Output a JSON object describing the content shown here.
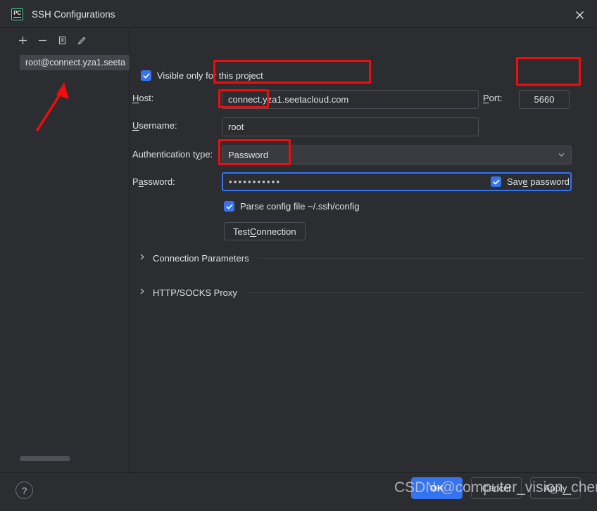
{
  "window": {
    "title": "SSH Configurations",
    "app_icon": "pycharm-icon",
    "app_icon_text": "PC",
    "close_icon": "close-icon"
  },
  "sidebar": {
    "toolbar": [
      {
        "name": "add-button",
        "icon": "plus-icon"
      },
      {
        "name": "remove-button",
        "icon": "minus-icon"
      },
      {
        "name": "copy-button",
        "icon": "copy-icon"
      },
      {
        "name": "edit-button",
        "icon": "pencil-icon"
      }
    ],
    "items": [
      {
        "label": "root@connect.yza1.seeta",
        "selected": true
      }
    ]
  },
  "form": {
    "visible_only_label": "Visible only for this project",
    "visible_only_checked": true,
    "host_label": "Host:",
    "host_label_mnemonic": "H",
    "host_label_rest": "ost:",
    "host_value": "connect.yza1.seetacloud.com",
    "port_label_mnemonic": "P",
    "port_label_rest": "ort:",
    "port_value": "5660",
    "username_label_mnemonic": "U",
    "username_label_rest": "sername:",
    "username_value": "root",
    "auth_label_pre": "Authentication t",
    "auth_label_mnemonic": "y",
    "auth_label_rest": "pe:",
    "auth_value": "Password",
    "auth_chevron": "chevron-down-icon",
    "password_label_pre": "P",
    "password_label_mnemonic": "a",
    "password_label_rest": "ssword:",
    "password_value": "•••••••••••",
    "save_password_pre": "Sav",
    "save_password_mnemonic": "e",
    "save_password_rest": " password",
    "save_password_checked": true,
    "parse_config_label": "Parse config file ~/.ssh/config",
    "parse_config_checked": true,
    "test_connection_pre": "Test ",
    "test_connection_mnemonic": "C",
    "test_connection_rest": "onnection"
  },
  "sections": [
    {
      "title": "Connection Parameters",
      "icon": "chevron-right-icon",
      "expanded": false
    },
    {
      "title": "HTTP/SOCKS Proxy",
      "icon": "chevron-right-icon",
      "expanded": false
    }
  ],
  "footer": {
    "help_label": "?",
    "ok_label": "OK",
    "cancel_label": "Cancel",
    "apply_pre": "A",
    "apply_mnemonic": "p",
    "apply_rest": "ply"
  },
  "watermark": "CSDN @computer_vision_chen",
  "colors": {
    "accent_blue": "#3574f0",
    "annotation_red": "#f20c0c",
    "background": "#2b2d30",
    "selection": "#43454a"
  }
}
